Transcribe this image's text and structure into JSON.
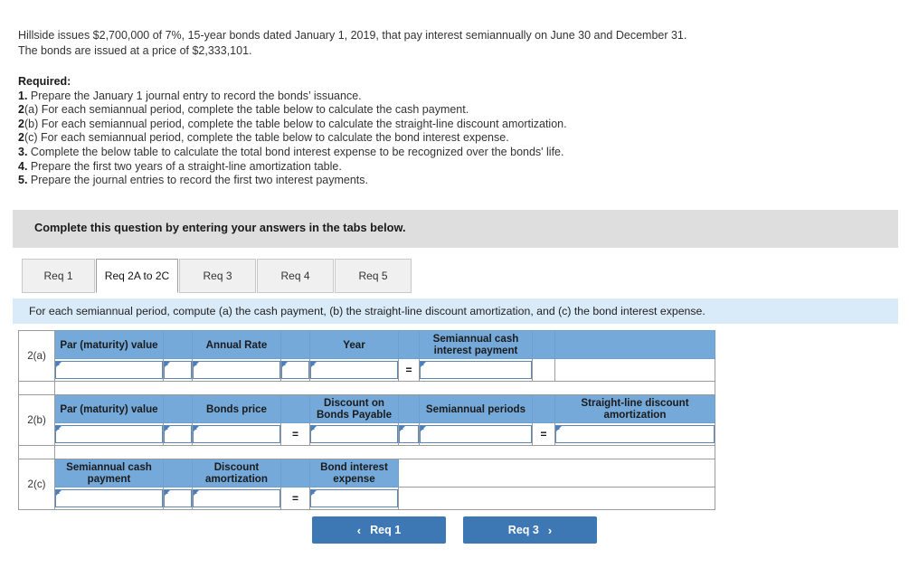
{
  "problem": {
    "line1": "Hillside issues $2,700,000 of 7%, 15-year bonds dated January 1, 2019, that pay interest semiannually on June 30 and December 31.",
    "line2": "The bonds are issued at a price of $2,333,101."
  },
  "required": {
    "heading": "Required:",
    "items": [
      {
        "num": "1.",
        "text": " Prepare the January 1 journal entry to record the bonds’ issuance."
      },
      {
        "num": "2",
        "text": "(a) For each semiannual period, complete the table below to calculate the cash payment."
      },
      {
        "num": "2",
        "text": "(b) For each semiannual period, complete the table below to calculate the straight-line discount amortization."
      },
      {
        "num": "2",
        "text": "(c) For each semiannual period, complete the table below to calculate the bond interest expense."
      },
      {
        "num": "3.",
        "text": " Complete the below table to calculate the total bond interest expense to be recognized over the bonds' life."
      },
      {
        "num": "4.",
        "text": " Prepare the first two years of a straight-line amortization table."
      },
      {
        "num": "5.",
        "text": " Prepare the journal entries to record the first two interest payments."
      }
    ]
  },
  "banner": {
    "text": "Complete this question by entering your answers in the tabs below."
  },
  "tabs": [
    {
      "label": "Req 1",
      "active": false
    },
    {
      "label": "Req 2A to 2C",
      "active": true
    },
    {
      "label": "Req 3",
      "active": false
    },
    {
      "label": "Req 4",
      "active": false
    },
    {
      "label": "Req 5",
      "active": false
    }
  ],
  "instruction": {
    "text": "For each semiannual period, compute (a) the cash payment, (b) the straight-line discount amortization, and (c) the bond interest expense."
  },
  "sections": {
    "a": {
      "label": "2(a)",
      "headers": [
        "Par (maturity) value",
        "Annual Rate",
        "Year",
        "Semiannual cash interest payment"
      ],
      "operators": [
        "",
        "",
        "="
      ],
      "values": [
        "",
        "",
        "",
        ""
      ]
    },
    "b": {
      "label": "2(b)",
      "headers": [
        "Par (maturity) value",
        "Bonds price",
        "Discount on Bonds Payable",
        "Semiannual periods",
        "Straight-line discount amortization"
      ],
      "operators": [
        "",
        "=",
        "",
        "="
      ],
      "values": [
        "",
        "",
        "",
        "",
        ""
      ]
    },
    "c": {
      "label": "2(c)",
      "headers": [
        "Semiannual cash payment",
        "Discount amortization",
        "Bond interest expense"
      ],
      "operators": [
        "",
        "="
      ],
      "values": [
        "",
        "",
        ""
      ]
    }
  },
  "nav": {
    "prev_label": "Req 1",
    "prev_chevron": "‹",
    "next_label": "Req 3",
    "next_chevron": "›"
  },
  "colors": {
    "header_blue": "#74a9da",
    "instruction_blue": "#d9ebf9",
    "banner_gray": "#dedede",
    "button_blue": "#3d78b4",
    "input_border": "#5b87b8"
  }
}
